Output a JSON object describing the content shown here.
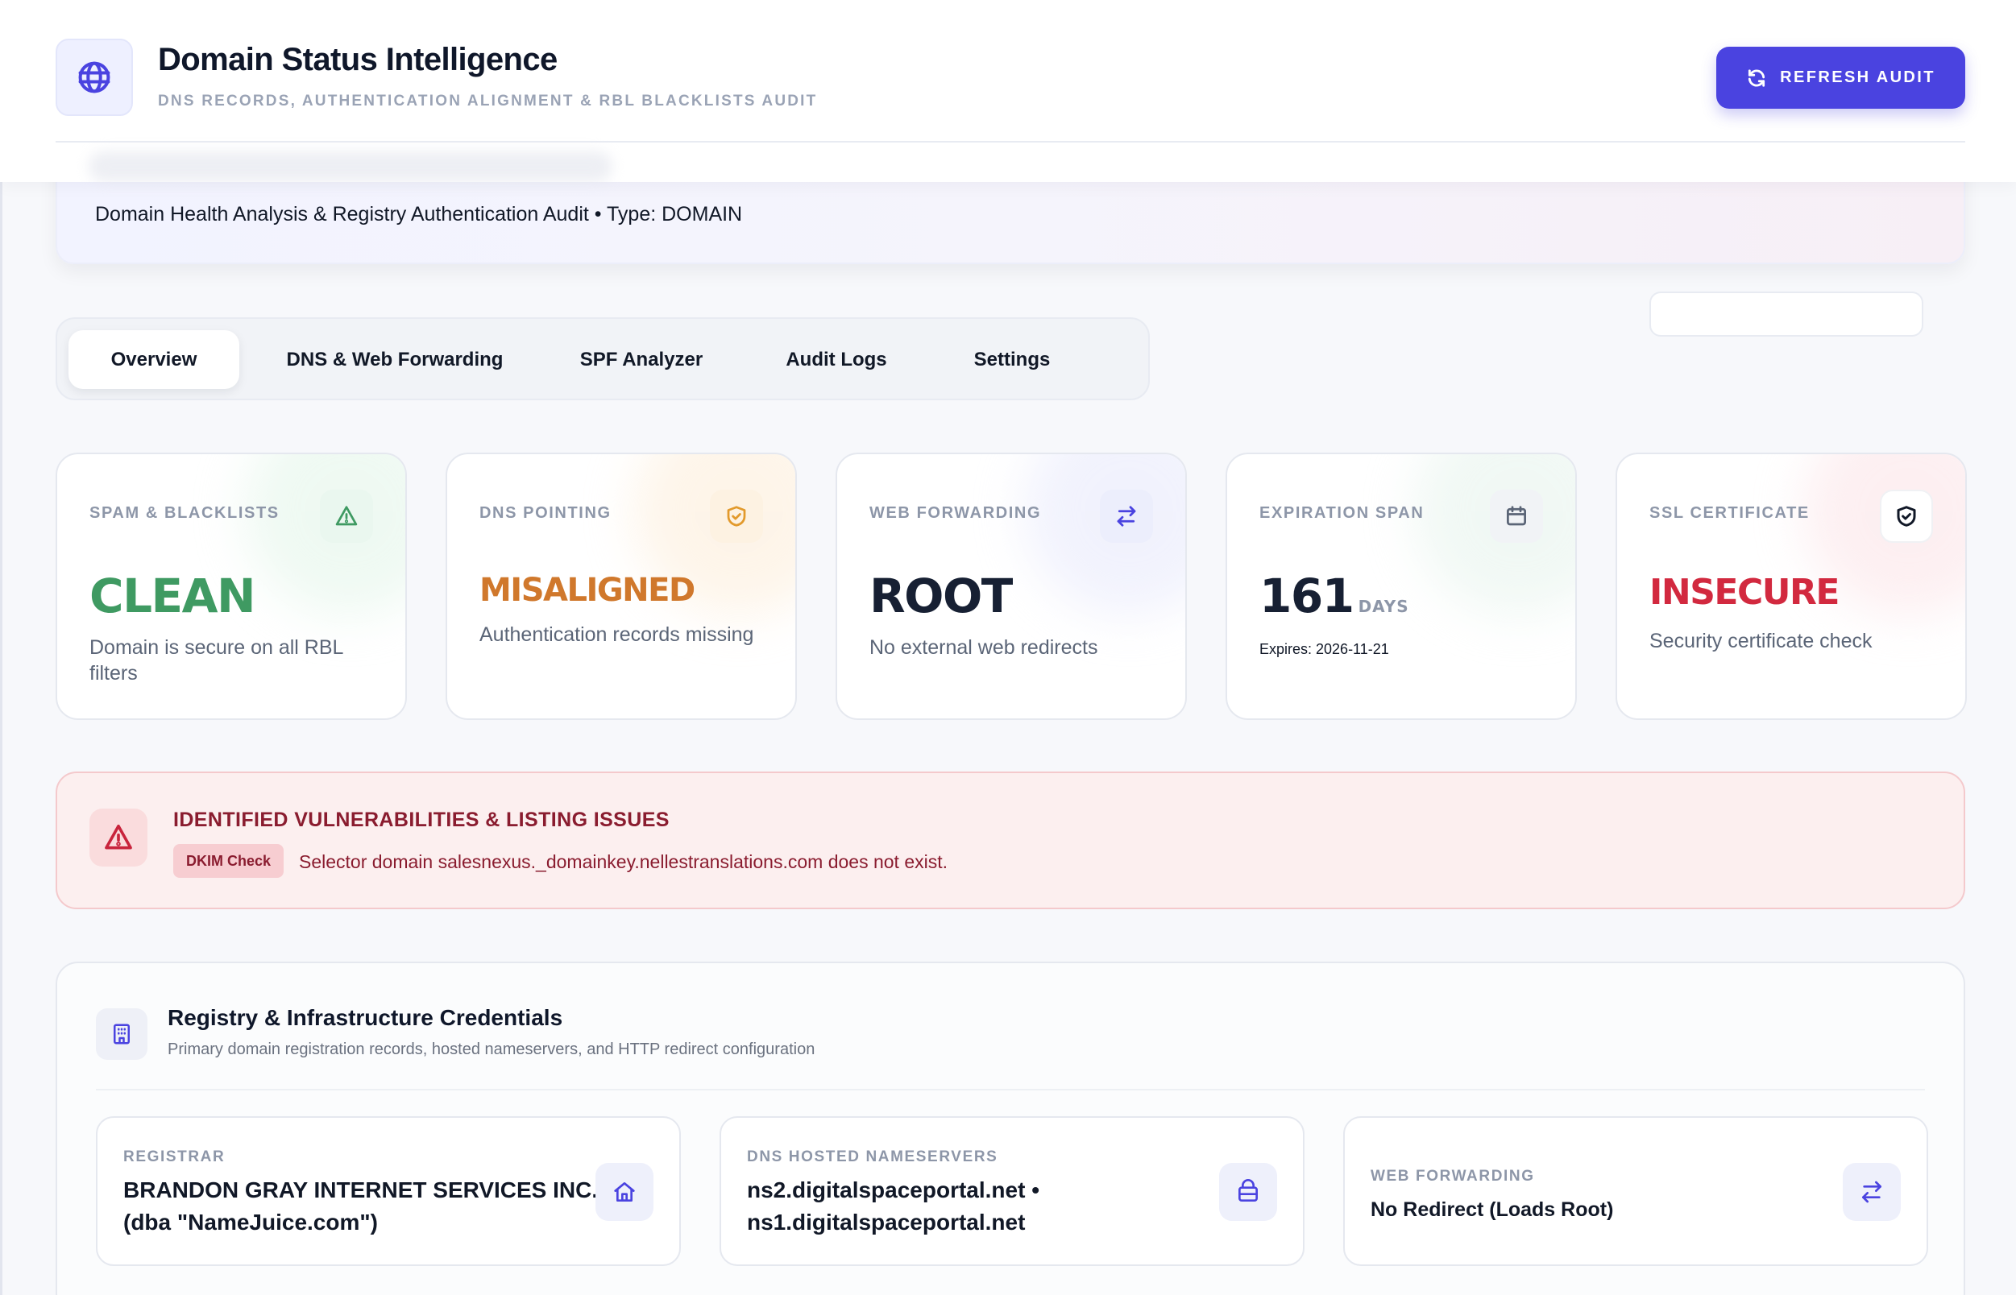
{
  "header": {
    "title": "Domain Status Intelligence",
    "subtitle": "DNS RECORDS, AUTHENTICATION ALIGNMENT & RBL BLACKLISTS AUDIT",
    "refresh_label": "REFRESH AUDIT",
    "icon": "globe-icon"
  },
  "hero": {
    "description": "Domain Health Analysis & Registry Authentication Audit • Type: DOMAIN"
  },
  "tabs": [
    {
      "label": "Overview",
      "active": true
    },
    {
      "label": "DNS & Web Forwarding",
      "active": false
    },
    {
      "label": "SPF Analyzer",
      "active": false
    },
    {
      "label": "Audit Logs",
      "active": false
    },
    {
      "label": "Settings",
      "active": false
    }
  ],
  "metrics": [
    {
      "label": "SPAM & BLACKLISTS",
      "value": "CLEAN",
      "description": "Domain is secure on all RBL filters",
      "color": "#3f9a62",
      "icon": "warning-triangle-icon"
    },
    {
      "label": "DNS POINTING",
      "value": "MISALIGNED",
      "description": "Authentication records missing",
      "color": "#d0782c",
      "icon": "shield-check-icon"
    },
    {
      "label": "WEB FORWARDING",
      "value": "ROOT",
      "description": "No external web redirects",
      "color": "#172033",
      "icon": "arrows-swap-icon"
    },
    {
      "label": "EXPIRATION SPAN",
      "value": "161",
      "unit": "DAYS",
      "description": "Expires: 2026-11-21",
      "color": "#172033",
      "icon": "calendar-icon"
    },
    {
      "label": "SSL CERTIFICATE",
      "value": "INSECURE",
      "description": "Security certificate check",
      "color": "#d2293f",
      "icon": "shield-icon"
    }
  ],
  "alert": {
    "title": "IDENTIFIED VULNERABILITIES & LISTING ISSUES",
    "badge": "DKIM Check",
    "message": "Selector domain salesnexus._domainkey.nellestranslations.com does not exist."
  },
  "registry": {
    "title": "Registry & Infrastructure Credentials",
    "subtitle": "Primary domain registration records, hosted nameservers, and HTTP redirect configuration",
    "cards": [
      {
        "label": "REGISTRAR",
        "line1": "BRANDON GRAY INTERNET SERVICES INC.",
        "line2": "(dba \"NameJuice.com\")",
        "icon": "home-icon"
      },
      {
        "label": "DNS HOSTED NAMESERVERS",
        "line1": "ns2.digitalspaceportal.net •",
        "line2": "ns1.digitalspaceportal.net",
        "icon": "server-icon"
      },
      {
        "label": "WEB FORWARDING",
        "line1": "No Redirect (Loads Root)",
        "icon": "arrows-swap-icon"
      }
    ]
  }
}
